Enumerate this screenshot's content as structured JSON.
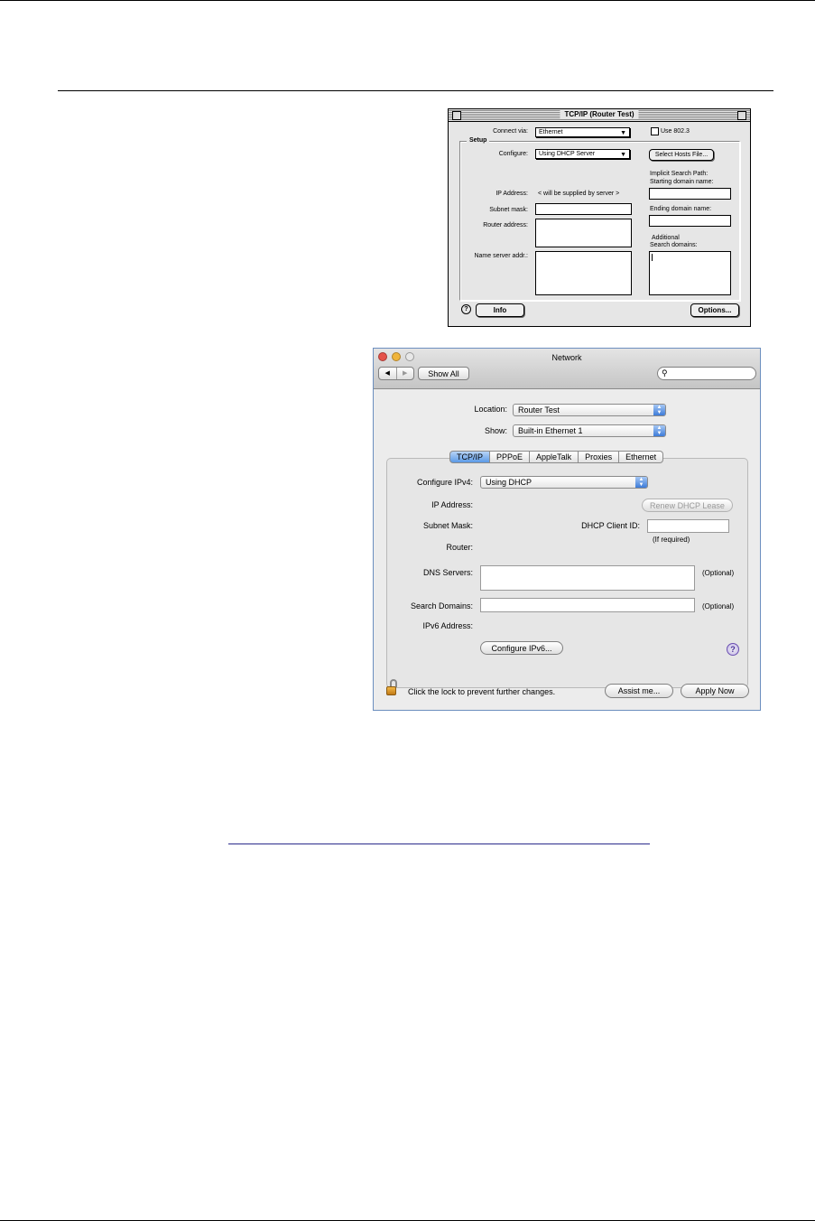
{
  "classic": {
    "title": "TCP/IP (Router Test)",
    "connect_via_label": "Connect via:",
    "connect_via_value": "Ethernet",
    "use_8023_label": "Use 802.3",
    "setup_label": "Setup",
    "configure_label": "Configure:",
    "configure_value": "Using DHCP Server",
    "select_hosts_button": "Select Hosts File...",
    "implicit_search_path": "Implicit Search Path:",
    "starting_domain_label": "Starting domain name:",
    "ip_address_label": "IP Address:",
    "ip_address_value": "< will be supplied by server >",
    "subnet_mask_label": "Subnet mask:",
    "ending_domain_label": "Ending domain name:",
    "router_address_label": "Router address:",
    "additional_label": "Additional",
    "search_domains_label": "Search domains:",
    "name_server_label": "Name server addr.:",
    "help_icon": "?",
    "info_button": "Info",
    "options_button": "Options..."
  },
  "network": {
    "title": "Network",
    "show_all_button": "Show All",
    "search_placeholder": "",
    "location_label": "Location:",
    "location_value": "Router Test",
    "show_label": "Show:",
    "show_value": "Built-in Ethernet 1",
    "tabs": [
      "TCP/IP",
      "PPPoE",
      "AppleTalk",
      "Proxies",
      "Ethernet"
    ],
    "active_tab": "TCP/IP",
    "configure_ipv4_label": "Configure IPv4:",
    "configure_ipv4_value": "Using DHCP",
    "ip_address_label": "IP Address:",
    "renew_dhcp_button": "Renew DHCP Lease",
    "subnet_mask_label": "Subnet Mask:",
    "dhcp_client_id_label": "DHCP Client ID:",
    "if_required": "(If required)",
    "router_label": "Router:",
    "dns_servers_label": "DNS Servers:",
    "optional_dns": "(Optional)",
    "search_domains_label": "Search Domains:",
    "optional_search": "(Optional)",
    "ipv6_address_label": "IPv6 Address:",
    "configure_ipv6_button": "Configure IPv6...",
    "help_icon": "?",
    "lock_text": "Click the lock to prevent further changes.",
    "assist_button": "Assist me...",
    "apply_button": "Apply Now"
  },
  "colors": {
    "close": "#e5524a",
    "minimize": "#f0b43a",
    "zoom": "#e8e8e8",
    "accent_blue": "#3d7bd8",
    "frame_border": "#6c8fbf"
  }
}
